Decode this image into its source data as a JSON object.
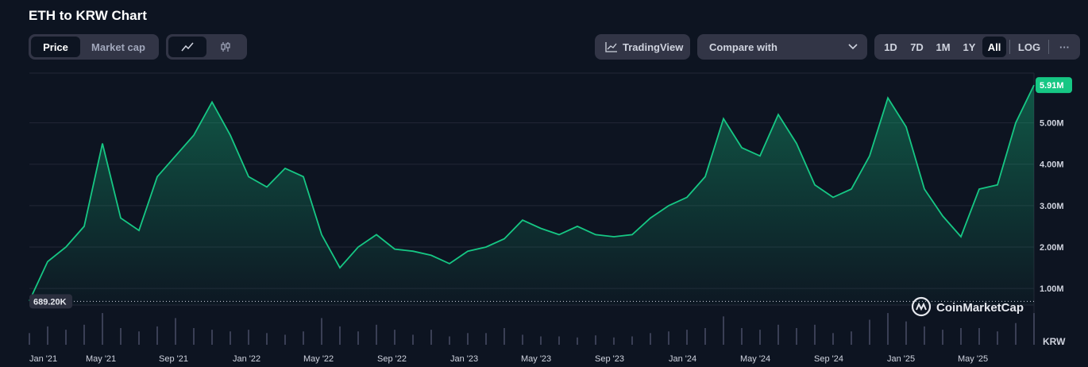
{
  "title": "ETH to KRW Chart",
  "toggle_metric": {
    "price": "Price",
    "market_cap": "Market cap"
  },
  "chart_type_icons": {
    "line": "line-chart-icon",
    "candle": "candlestick-icon"
  },
  "tradingview": {
    "label": "TradingView",
    "icon": "tradingview-icon"
  },
  "compare": {
    "label": "Compare with",
    "icon": "chevron-down-icon"
  },
  "ranges": [
    "1D",
    "7D",
    "1M",
    "1Y",
    "All"
  ],
  "active_range": "All",
  "log_label": "LOG",
  "more_label": "···",
  "watermark": "CoinMarketCap",
  "colors": {
    "line": "#16c784",
    "badge": "#16c784",
    "bg": "#0d1421",
    "volume": "#3a3f55"
  },
  "chart_data": {
    "type": "area",
    "currency": "KRW",
    "x_ticks": [
      "Jan '21",
      "May '21",
      "Sep '21",
      "Jan '22",
      "May '22",
      "Sep '22",
      "Jan '23",
      "May '23",
      "Sep '23",
      "Jan '24",
      "May '24",
      "Sep '24",
      "Jan '25",
      "May '25"
    ],
    "y_ticks": [
      "1.00M",
      "2.00M",
      "3.00M",
      "4.00M",
      "5.00M"
    ],
    "y_tick_values": [
      1000000,
      2000000,
      3000000,
      4000000,
      5000000
    ],
    "ylim": [
      600000,
      6200000
    ],
    "current_price_label": "5.91M",
    "current_price": 5910000,
    "start_price_label": "689.20K",
    "start_price": 689200,
    "grid": true,
    "x": [
      "2021-01",
      "2021-02",
      "2021-03",
      "2021-04",
      "2021-05",
      "2021-06",
      "2021-07",
      "2021-08",
      "2021-09",
      "2021-10",
      "2021-11",
      "2021-12",
      "2022-01",
      "2022-02",
      "2022-03",
      "2022-04",
      "2022-05",
      "2022-06",
      "2022-07",
      "2022-08",
      "2022-09",
      "2022-10",
      "2022-11",
      "2022-12",
      "2023-01",
      "2023-02",
      "2023-03",
      "2023-04",
      "2023-05",
      "2023-06",
      "2023-07",
      "2023-08",
      "2023-09",
      "2023-10",
      "2023-11",
      "2023-12",
      "2024-01",
      "2024-02",
      "2024-03",
      "2024-04",
      "2024-05",
      "2024-06",
      "2024-07",
      "2024-08",
      "2024-09",
      "2024-10",
      "2024-11",
      "2024-12",
      "2025-01",
      "2025-02",
      "2025-03",
      "2025-04",
      "2025-05",
      "2025-06",
      "2025-07",
      "2025-08"
    ],
    "values": [
      700000,
      1650000,
      2000000,
      2500000,
      4500000,
      2700000,
      2400000,
      3700000,
      4200000,
      4700000,
      5500000,
      4700000,
      3700000,
      3450000,
      3900000,
      3700000,
      2300000,
      1500000,
      2000000,
      2300000,
      1950000,
      1900000,
      1800000,
      1600000,
      1900000,
      2000000,
      2200000,
      2650000,
      2450000,
      2300000,
      2500000,
      2300000,
      2250000,
      2300000,
      2700000,
      3000000,
      3200000,
      3700000,
      5100000,
      4400000,
      4200000,
      5200000,
      4500000,
      3500000,
      3200000,
      3400000,
      4200000,
      5600000,
      4900000,
      3400000,
      2750000,
      2250000,
      3400000,
      3500000,
      5000000,
      5910000
    ],
    "volume": [
      0.35,
      0.55,
      0.45,
      0.6,
      0.95,
      0.5,
      0.4,
      0.55,
      0.8,
      0.5,
      0.45,
      0.4,
      0.45,
      0.35,
      0.3,
      0.4,
      0.8,
      0.55,
      0.4,
      0.6,
      0.45,
      0.3,
      0.45,
      0.25,
      0.35,
      0.35,
      0.5,
      0.3,
      0.25,
      0.25,
      0.22,
      0.28,
      0.22,
      0.25,
      0.35,
      0.4,
      0.45,
      0.5,
      0.85,
      0.5,
      0.45,
      0.6,
      0.5,
      0.6,
      0.35,
      0.4,
      0.75,
      0.95,
      0.7,
      0.55,
      0.45,
      0.5,
      0.5,
      0.4,
      0.65,
      0.95
    ]
  }
}
